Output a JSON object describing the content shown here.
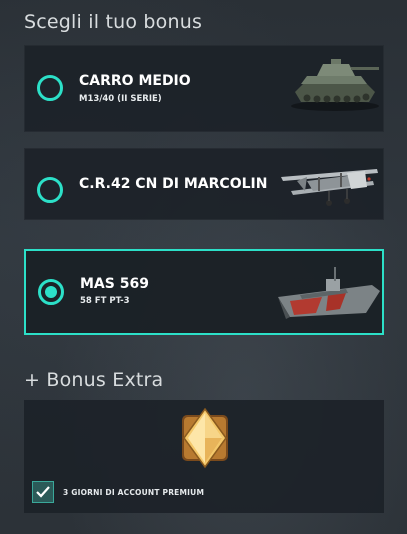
{
  "section_title": "Scegli il tuo bonus",
  "accent_color": "#2ce0c8",
  "options": [
    {
      "title": "CARRO MEDIO",
      "subtitle": "M13/40 (II SERIE)",
      "selected": false,
      "icon": "tank-icon"
    },
    {
      "title": "C.R.42 CN DI MARCOLIN",
      "subtitle": "",
      "selected": false,
      "icon": "biplane-icon"
    },
    {
      "title": "MAS 569",
      "subtitle": "58 FT PT-3",
      "selected": true,
      "icon": "boat-icon"
    }
  ],
  "extra_title": "+ Bonus Extra",
  "extra": {
    "label": "3 GIORNI DI ACCOUNT PREMIUM",
    "checked": true,
    "icon": "premium-diamond-icon"
  }
}
